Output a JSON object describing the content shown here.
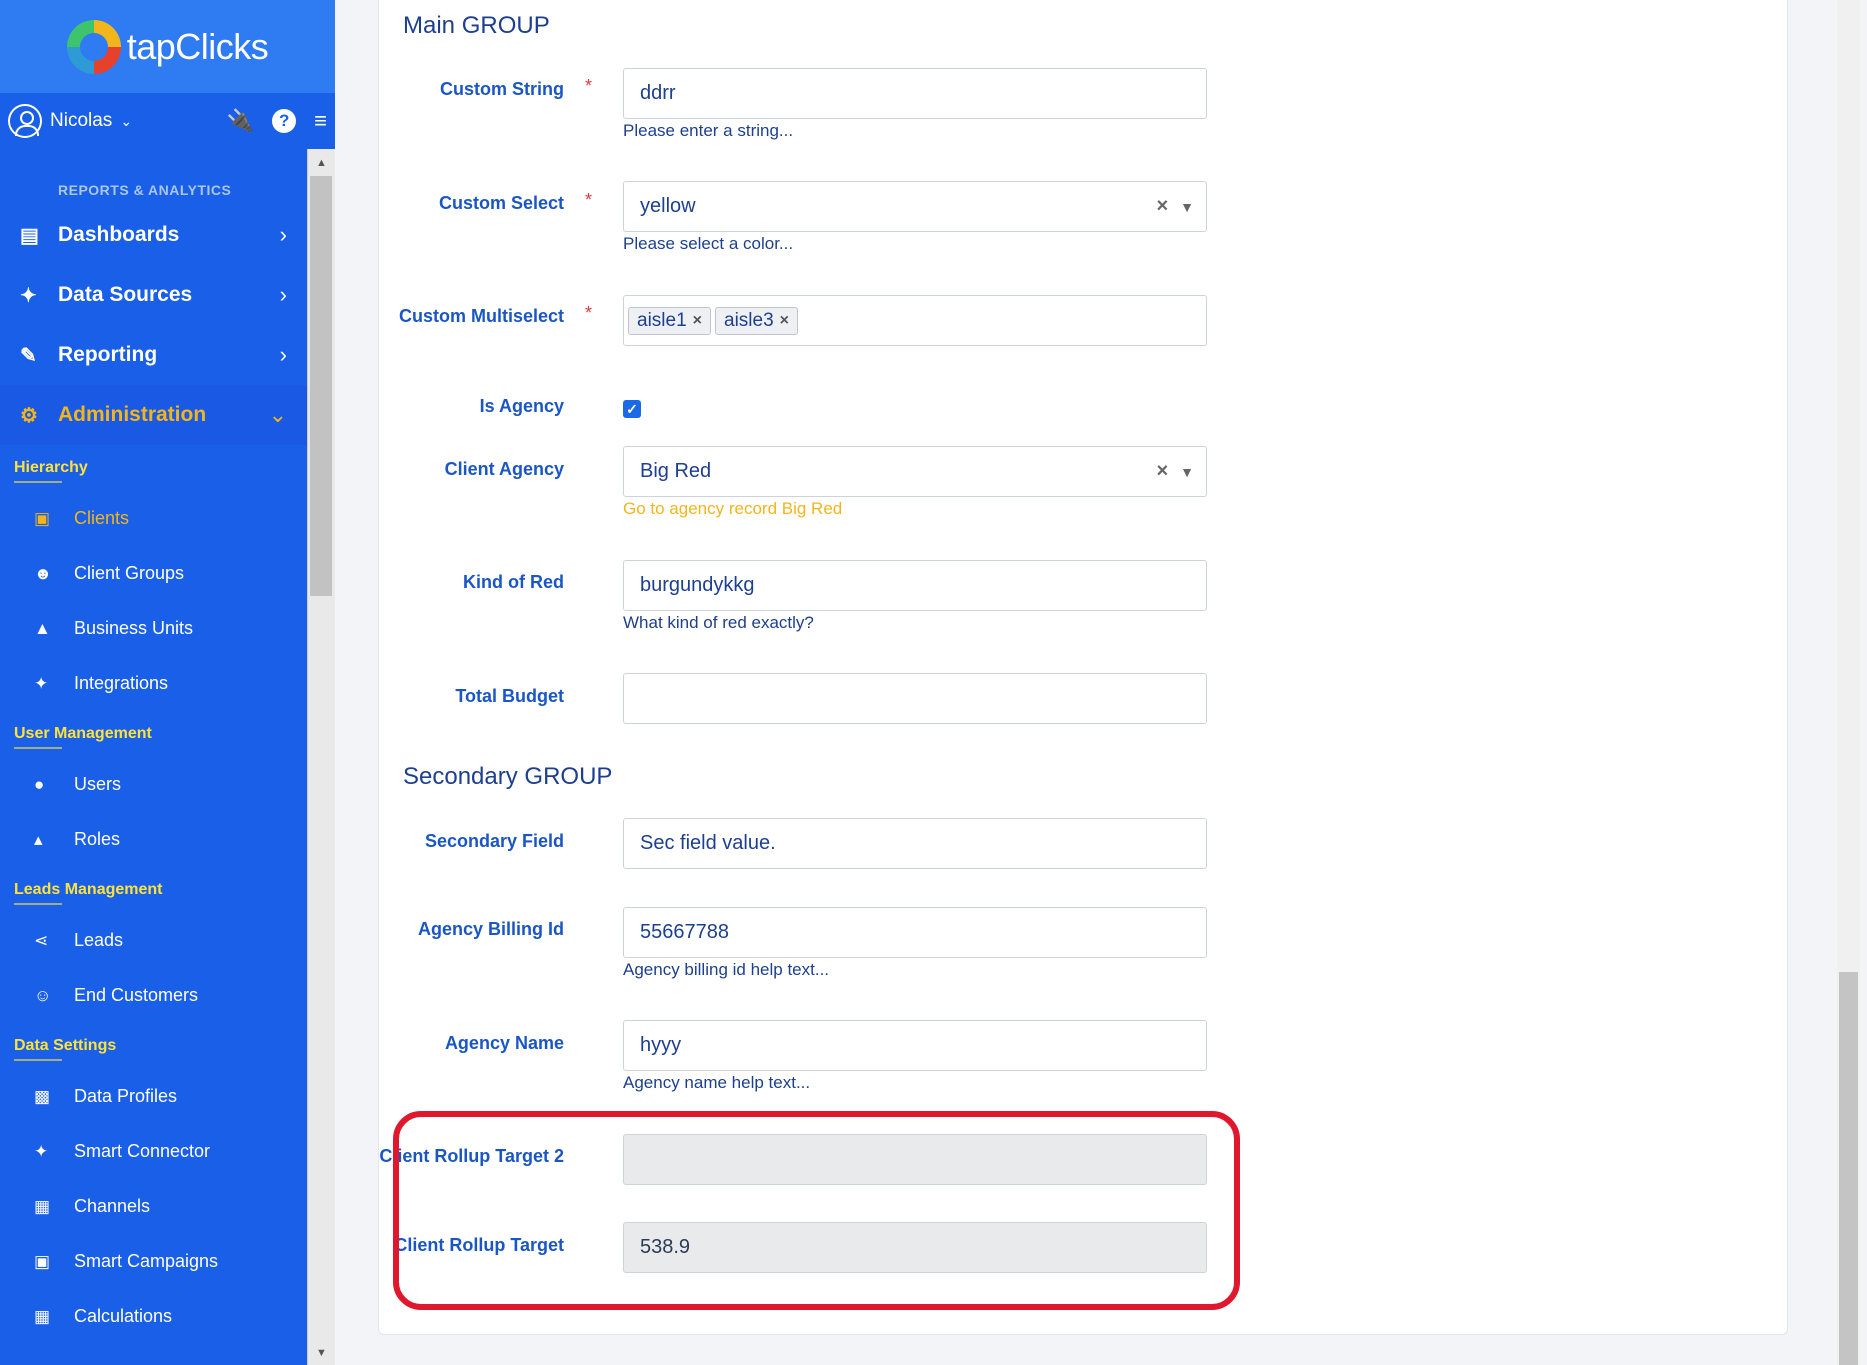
{
  "brand": {
    "name": "tapClicks"
  },
  "user": {
    "name": "Nicolas"
  },
  "sidebar": {
    "section_title": "REPORTS & ANALYTICS",
    "main_items": [
      {
        "label": "Dashboards",
        "icon": "dashboard-icon"
      },
      {
        "label": "Data Sources",
        "icon": "plug-icon"
      },
      {
        "label": "Reporting",
        "icon": "report-icon"
      },
      {
        "label": "Administration",
        "icon": "gear-icon"
      }
    ],
    "groups": [
      {
        "title": "Hierarchy",
        "items": [
          {
            "label": "Clients",
            "icon": "briefcase-icon"
          },
          {
            "label": "Client Groups",
            "icon": "users-icon"
          },
          {
            "label": "Business Units",
            "icon": "sitemap-icon"
          },
          {
            "label": "Integrations",
            "icon": "plug-icon"
          }
        ]
      },
      {
        "title": "User Management",
        "items": [
          {
            "label": "Users",
            "icon": "user-icon"
          },
          {
            "label": "Roles",
            "icon": "roles-icon"
          }
        ]
      },
      {
        "title": "Leads Management",
        "items": [
          {
            "label": "Leads",
            "icon": "share-icon"
          },
          {
            "label": "End Customers",
            "icon": "customers-icon"
          }
        ]
      },
      {
        "title": "Data Settings",
        "items": [
          {
            "label": "Data Profiles",
            "icon": "profile-icon"
          },
          {
            "label": "Smart Connector",
            "icon": "plug-icon"
          },
          {
            "label": "Channels",
            "icon": "grid-icon"
          },
          {
            "label": "Smart Campaigns",
            "icon": "image-icon"
          },
          {
            "label": "Calculations",
            "icon": "calculator-icon"
          }
        ]
      }
    ]
  },
  "form": {
    "main_group_title": "Main GROUP",
    "secondary_group_title": "Secondary GROUP",
    "custom_string": {
      "label": "Custom String",
      "value": "ddrr",
      "help": "Please enter a string..."
    },
    "custom_select": {
      "label": "Custom Select",
      "value": "yellow",
      "help": "Please select a color..."
    },
    "custom_multiselect": {
      "label": "Custom Multiselect",
      "tags": [
        "aisle1",
        "aisle3"
      ]
    },
    "is_agency": {
      "label": "Is Agency",
      "checked": true
    },
    "client_agency": {
      "label": "Client Agency",
      "value": "Big Red",
      "help": "Go to agency record Big Red"
    },
    "kind_of_red": {
      "label": "Kind of Red",
      "value": "burgundykkg",
      "help": "What kind of red exactly?"
    },
    "total_budget": {
      "label": "Total Budget",
      "value": ""
    },
    "secondary_field": {
      "label": "Secondary Field",
      "value": "Sec field value."
    },
    "agency_billing_id": {
      "label": "Agency Billing Id",
      "value": "55667788",
      "help": "Agency billing id help text..."
    },
    "agency_name": {
      "label": "Agency Name",
      "value": "hyyy",
      "help": "Agency name help text..."
    },
    "client_rollup_target_2": {
      "label": "Client Rollup Target 2",
      "value": ""
    },
    "client_rollup_target": {
      "label": "Client Rollup Target",
      "value": "538.9"
    }
  },
  "colors": {
    "sidebar": "#1a5fe8",
    "accent": "#f2b51c",
    "highlight": "#e0182d"
  }
}
